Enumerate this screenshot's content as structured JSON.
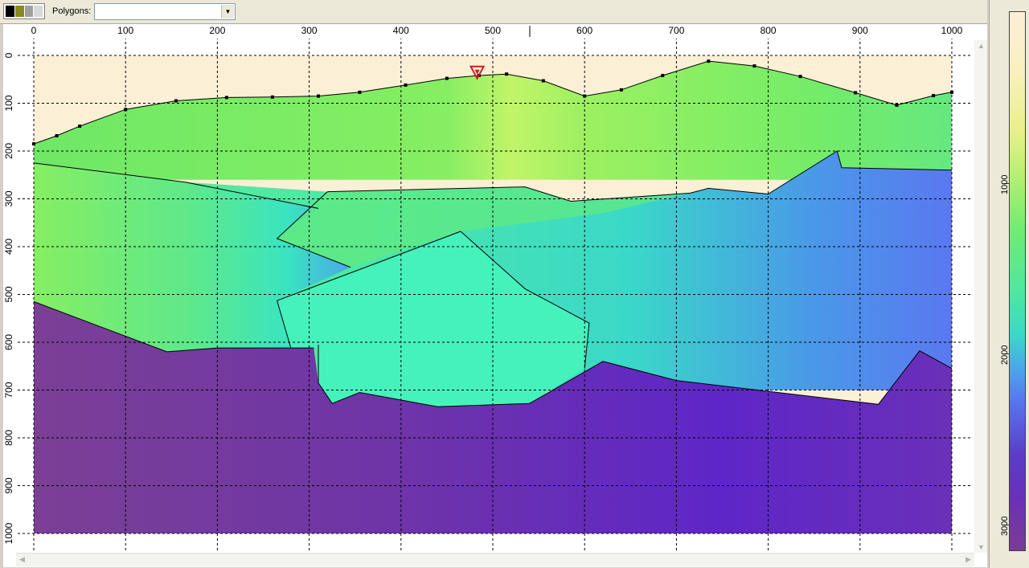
{
  "toolbar": {
    "polygons_label": "Polygons:",
    "polygons_value": "",
    "swatch_colors": [
      "#000000",
      "#8a8a20",
      "#a0a0a0",
      "#d8d8d8"
    ]
  },
  "plot": {
    "x_ticks": [
      "0",
      "100",
      "200",
      "300",
      "400",
      "500",
      "600",
      "700",
      "800",
      "900",
      "1000"
    ],
    "y_ticks": [
      "0",
      "100",
      "200",
      "300",
      "400",
      "500",
      "600",
      "700",
      "800",
      "900",
      "1000"
    ],
    "x_range": [
      0,
      1000
    ],
    "y_range": [
      0,
      1000
    ],
    "grid": "dashed",
    "surface_points": [
      [
        0,
        185
      ],
      [
        25,
        168
      ],
      [
        50,
        148
      ],
      [
        100,
        113
      ],
      [
        155,
        95
      ],
      [
        210,
        88
      ],
      [
        260,
        87
      ],
      [
        310,
        85
      ],
      [
        355,
        77
      ],
      [
        405,
        62
      ],
      [
        450,
        48
      ],
      [
        485,
        42
      ],
      [
        515,
        39
      ],
      [
        555,
        53
      ],
      [
        600,
        85
      ],
      [
        640,
        72
      ],
      [
        685,
        42
      ],
      [
        735,
        12
      ],
      [
        785,
        22
      ],
      [
        835,
        44
      ],
      [
        895,
        78
      ],
      [
        940,
        104
      ],
      [
        980,
        84
      ],
      [
        1000,
        77
      ]
    ],
    "interfaces": [
      [
        [
          0,
          225
        ],
        [
          165,
          265
        ],
        [
          310,
          320
        ]
      ],
      [
        [
          0,
          515
        ],
        [
          145,
          620
        ],
        [
          200,
          612
        ],
        [
          305,
          612
        ]
      ],
      [
        [
          310,
          605
        ],
        [
          310,
          685
        ],
        [
          325,
          728
        ],
        [
          355,
          705
        ],
        [
          440,
          735
        ],
        [
          540,
          728
        ],
        [
          620,
          640
        ],
        [
          700,
          680
        ],
        [
          920,
          730
        ],
        [
          965,
          618
        ],
        [
          1000,
          655
        ]
      ],
      [
        [
          320,
          285
        ],
        [
          535,
          275
        ],
        [
          585,
          305
        ],
        [
          715,
          288
        ],
        [
          735,
          278
        ],
        [
          800,
          290
        ],
        [
          875,
          200
        ],
        [
          880,
          235
        ],
        [
          1000,
          240
        ]
      ],
      [
        [
          320,
          285
        ],
        [
          265,
          383
        ],
        [
          345,
          443
        ]
      ],
      [
        [
          465,
          368
        ],
        [
          535,
          488
        ],
        [
          605,
          560
        ],
        [
          600,
          655
        ]
      ],
      [
        [
          265,
          513
        ],
        [
          465,
          368
        ]
      ],
      [
        [
          265,
          513
        ],
        [
          280,
          612
        ]
      ]
    ],
    "marker_source": [
      483,
      40
    ]
  },
  "colorbar": {
    "labels": [
      "1000",
      "2000",
      "3000"
    ],
    "ticks": [
      1000,
      2000,
      3000
    ],
    "range": [
      0,
      3150
    ]
  },
  "colors": {
    "air": "#fbefd6",
    "layer_top": "#80ec6a",
    "layer_mid_left": "#5ee88a",
    "layer_mid_right": "#4aa0e8",
    "lens": "#46f2bc",
    "basement": "#6a3aa8",
    "marker": "#c81e1e"
  }
}
